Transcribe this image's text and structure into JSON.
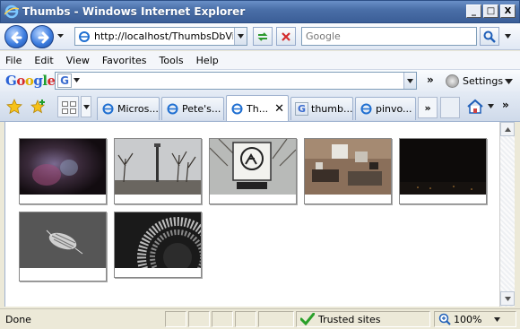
{
  "window": {
    "title": "Thumbs - Windows Internet Explorer",
    "controls": {
      "minimize": "_",
      "maximize": "□",
      "close": "X"
    }
  },
  "address_bar": {
    "url": "http://localhost/ThumbsDbViewer/",
    "search_placeholder": "Google"
  },
  "menu": {
    "items": [
      "File",
      "Edit",
      "View",
      "Favorites",
      "Tools",
      "Help"
    ]
  },
  "google_toolbar": {
    "logo": "Google",
    "search_icon_letter": "G",
    "settings_label": "Settings",
    "chevron": "»"
  },
  "tabs": [
    {
      "label": "Micros...",
      "icon": "ie-page-icon",
      "active": false
    },
    {
      "label": "Pete's...",
      "icon": "ie-page-icon",
      "active": false
    },
    {
      "label": "Th...",
      "icon": "ie-page-icon",
      "active": true,
      "close": "✕"
    },
    {
      "label": "thumb...",
      "icon": "google-g-icon",
      "active": false
    },
    {
      "label": "pinvo...",
      "icon": "ie-page-icon",
      "active": false
    }
  ],
  "tab_more": "»",
  "thumbnails": [
    {
      "name": "thumbnail-1",
      "description_icon": "blurry-dark-photo"
    },
    {
      "name": "thumbnail-2",
      "description_icon": "column-trees-photo"
    },
    {
      "name": "thumbnail-3",
      "description_icon": "dog-sign-photo"
    },
    {
      "name": "thumbnail-4",
      "description_icon": "office-room-photo"
    },
    {
      "name": "thumbnail-5",
      "description_icon": "night-sky-photo"
    },
    {
      "name": "thumbnail-6",
      "description_icon": "woodlouse-photo"
    },
    {
      "name": "thumbnail-7",
      "description_icon": "fan-grille-photo"
    }
  ],
  "status": {
    "text": "Done",
    "zone": "Trusted sites",
    "zoom": "100%"
  },
  "colors": {
    "titlebar": "#4a6fa8",
    "accent": "#3e7ee0",
    "trusted_check": "#2aa02a"
  }
}
